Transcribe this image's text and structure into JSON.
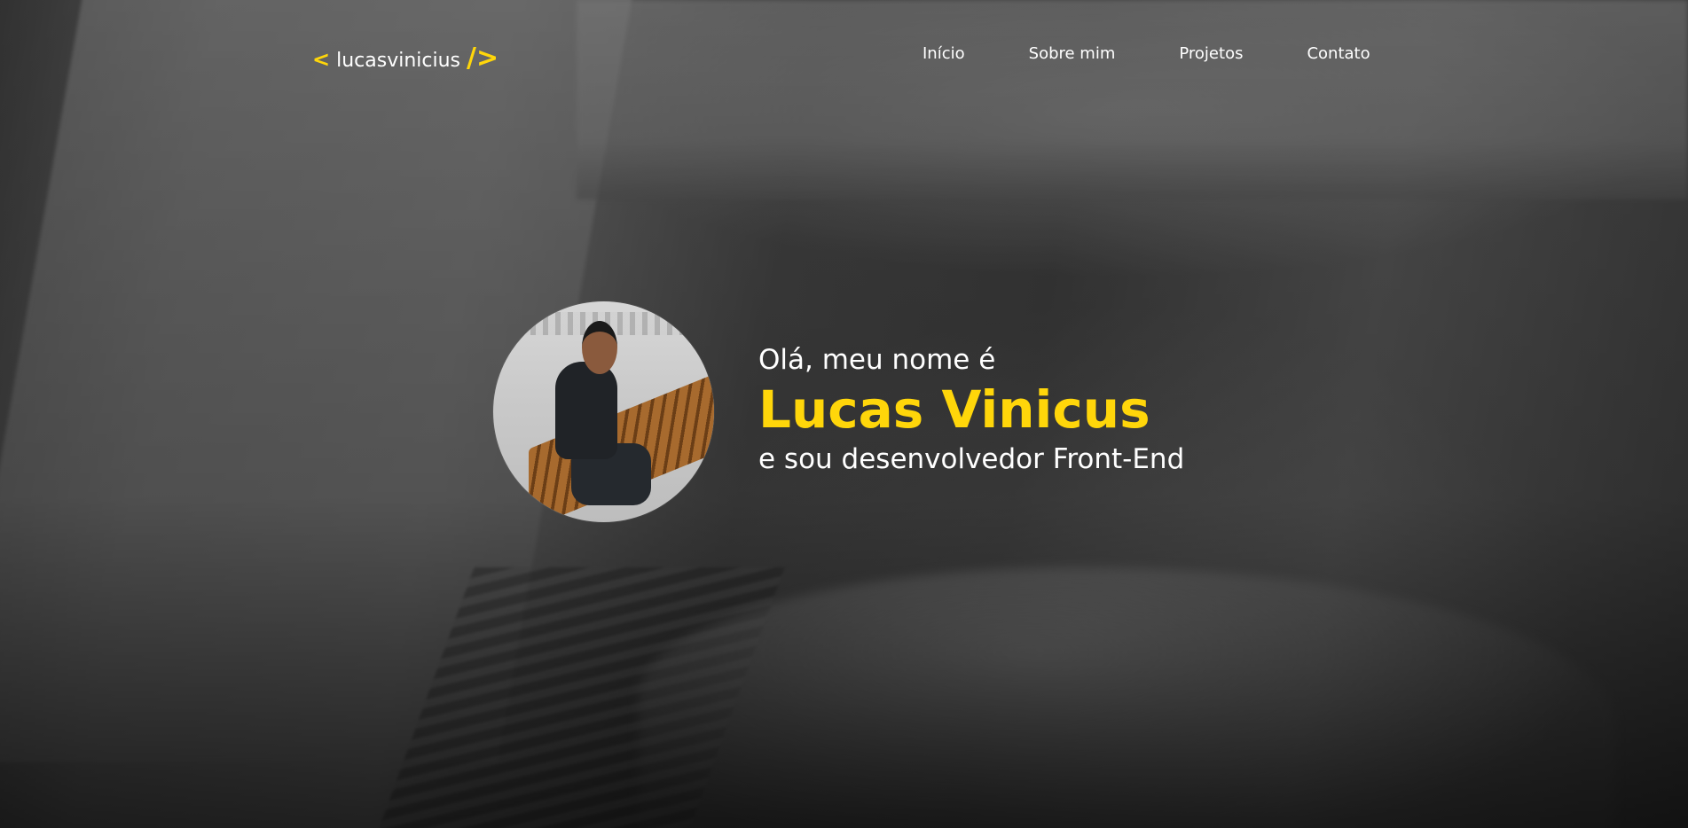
{
  "header": {
    "logo": {
      "open_bracket": "<",
      "text": "lucasvinicius",
      "close_bracket": "/>"
    },
    "nav": [
      {
        "label": "Início"
      },
      {
        "label": "Sobre mim"
      },
      {
        "label": "Projetos"
      },
      {
        "label": "Contato"
      }
    ]
  },
  "hero": {
    "greeting": "Olá, meu nome é",
    "name": "Lucas Vinicus",
    "role": "e sou desenvolvedor Front-End",
    "avatar_alt": "profile-photo"
  },
  "colors": {
    "accent": "#ffd60a",
    "text": "#ffffff"
  }
}
